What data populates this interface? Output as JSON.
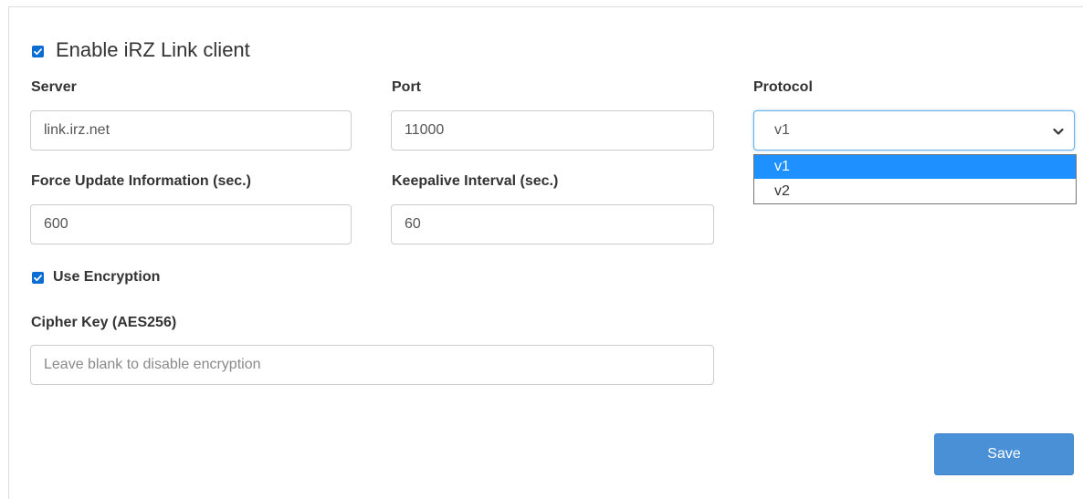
{
  "form": {
    "enable_client": {
      "label": "Enable iRZ Link client",
      "checked": true
    },
    "server": {
      "label": "Server",
      "value": "link.irz.net"
    },
    "port": {
      "label": "Port",
      "value": "11000"
    },
    "protocol": {
      "label": "Protocol",
      "selected": "v1",
      "options": [
        "v1",
        "v2"
      ]
    },
    "force_update": {
      "label": "Force Update Information (sec.)",
      "value": "600"
    },
    "keepalive": {
      "label": "Keepalive Interval (sec.)",
      "value": "60"
    },
    "use_encryption": {
      "label": "Use Encryption",
      "checked": true
    },
    "cipher_key": {
      "label": "Cipher Key (AES256)",
      "value": "",
      "placeholder": "Leave blank to disable encryption"
    },
    "save_label": "Save"
  },
  "colors": {
    "checkbox": "#0b6cd1",
    "select_highlight": "#1e90ff",
    "save_button": "#4a90d6"
  },
  "icons": {
    "checkbox": "check-icon",
    "select_arrow": "chevron-down-icon"
  }
}
